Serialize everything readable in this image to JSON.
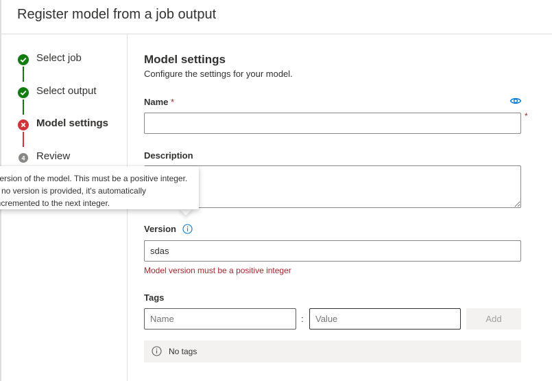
{
  "header": {
    "title": "Register model from a job output"
  },
  "steps": [
    {
      "label": "Select job",
      "status": "done"
    },
    {
      "label": "Select output",
      "status": "done"
    },
    {
      "label": "Model settings",
      "status": "error"
    },
    {
      "label": "Review",
      "status": "pending",
      "number": "4"
    }
  ],
  "colors": {
    "success": "#107c10",
    "error": "#d13438",
    "pending": "#8a8886",
    "link": "#0078d4"
  },
  "section": {
    "title": "Model settings",
    "description": "Configure the settings for your model."
  },
  "fields": {
    "name_label": "Name",
    "required_mark": "*",
    "name_value": "",
    "description_label": "Description",
    "description_value": "",
    "version_label": "Version",
    "version_value": "sdas",
    "version_error": "Model version must be a positive integer",
    "tags_label": "Tags",
    "tag_name_placeholder": "Name",
    "tag_value_placeholder": "Value",
    "tag_separator": ":",
    "add_label": "Add",
    "no_tags": "No tags"
  },
  "tooltip": {
    "lines": [
      "Version of the model. This must be a positive integer.",
      "If no version is provided, it's automatically",
      "incremented to the next integer."
    ]
  }
}
